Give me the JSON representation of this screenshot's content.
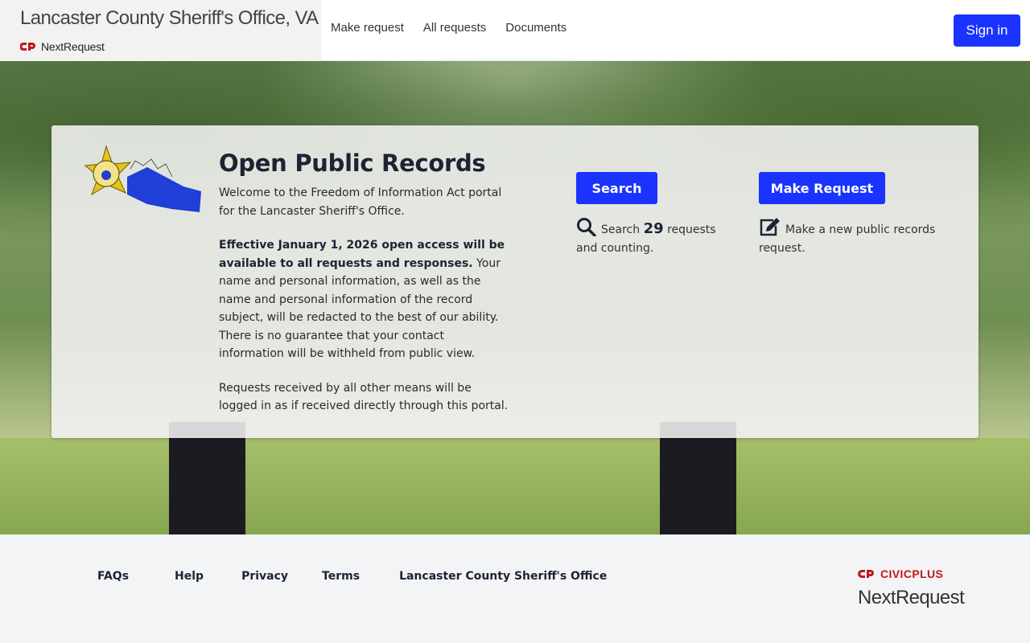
{
  "header": {
    "agency_name": "Lancaster County Sheriff's Office, VA",
    "product_name": "NextRequest",
    "nav": [
      "Make request",
      "All requests",
      "Documents"
    ],
    "sign_in_label": "Sign in"
  },
  "hero": {
    "title": "Open Public Records",
    "intro_1": "Welcome to the Freedom of Information Act portal for the Lancaster Sheriff's Office.",
    "intro_2_bold": "Effective January 1, 2026 open access will be available to all requests and responses.",
    "intro_2_rest": " Your name and personal information, as well as the name and personal information of the record subject, will be redacted to the best of our ability. There is no guarantee that your contact information will be withheld from public view.",
    "intro_3": "Requests received by all other means will be logged in as if received directly through this portal.",
    "search_button": "Search",
    "search_text_before": "Search",
    "search_count": "29",
    "search_text_after": "requests and counting.",
    "make_request_button": "Make Request",
    "make_request_text": "Make a new public records request.",
    "icons": {
      "search": "search-icon",
      "edit": "edit-icon",
      "badge": "sheriff-badge-logo"
    }
  },
  "footer": {
    "links": [
      "FAQs",
      "Help",
      "Privacy",
      "Terms",
      "Lancaster County Sheriff's Office"
    ],
    "civicplus_label": "CIVICPLUS",
    "nextrequest_label": "NextRequest"
  },
  "colors": {
    "primary_button": "#1a33ff",
    "brand_red": "#c4161c",
    "title_text": "#1e2232"
  }
}
